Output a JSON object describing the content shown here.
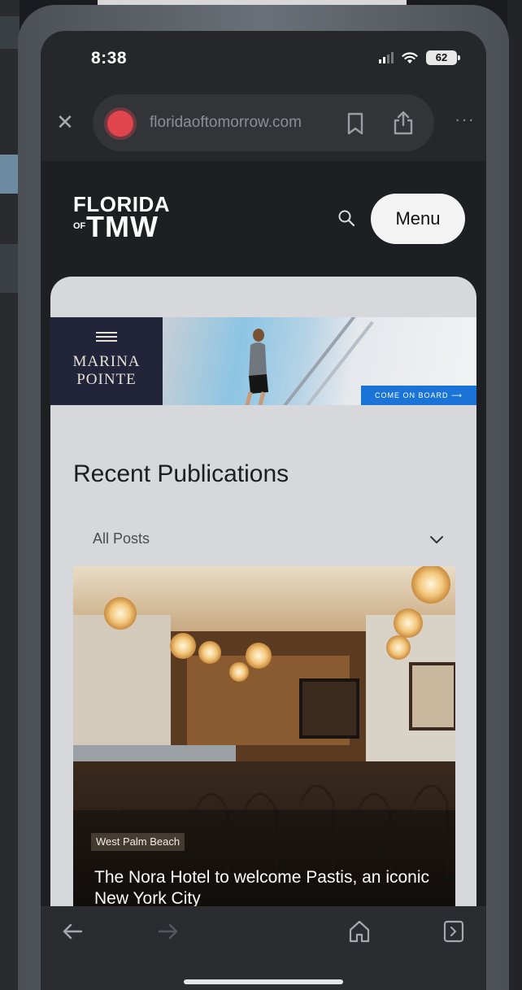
{
  "status_bar": {
    "time": "8:38",
    "battery": "62"
  },
  "browser": {
    "url": "floridaoftomorrow.com",
    "close_icon": "close-icon",
    "more": "···"
  },
  "site": {
    "logo_top": "FLORIDA",
    "logo_of": "OF",
    "logo_bottom": "TMW",
    "menu_label": "Menu"
  },
  "ad": {
    "brand_line1": "MARINA",
    "brand_line2": "POINTE",
    "cta": "COME ON BOARD ⟶"
  },
  "section": {
    "title": "Recent Publications",
    "filter_value": "All Posts"
  },
  "article": {
    "tag": "West Palm Beach",
    "title": "The Nora Hotel to welcome Pastis, an iconic New York City"
  },
  "colors": {
    "accent_site_icon": "#e0444d",
    "cta_blue": "#1a74d8",
    "ad_navy": "#22243a"
  }
}
